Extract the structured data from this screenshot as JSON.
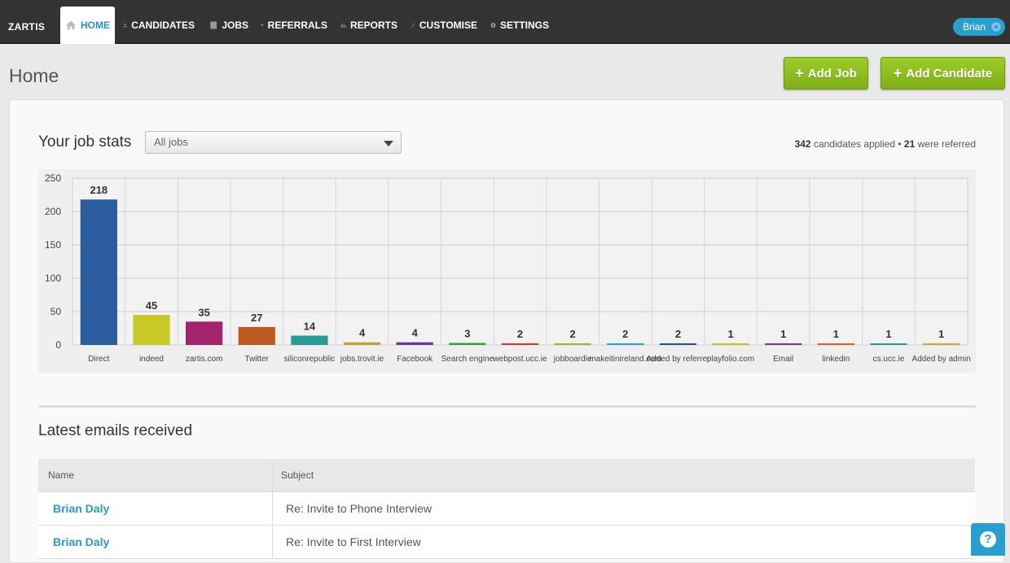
{
  "app": {
    "brand": "ZARTIS"
  },
  "nav": [
    {
      "label": "HOME",
      "icon": "home-icon",
      "active": true
    },
    {
      "label": "CANDIDATES",
      "icon": "person-icon"
    },
    {
      "label": "JOBS",
      "icon": "document-icon"
    },
    {
      "label": "REFERRALS",
      "icon": "handshake-icon"
    },
    {
      "label": "REPORTS",
      "icon": "bar-chart-icon"
    },
    {
      "label": "CUSTOMISE",
      "icon": "brush-icon"
    },
    {
      "label": "SETTINGS",
      "icon": "gear-icon"
    }
  ],
  "user": {
    "name": "Brian",
    "icon": "gear-icon"
  },
  "page": {
    "title": "Home"
  },
  "actions": {
    "add_job": "Add Job",
    "add_candidate": "Add Candidate",
    "plus": "+"
  },
  "stats": {
    "title": "Your job stats",
    "filter_value": "All jobs",
    "candidates_count": "342",
    "candidates_label": "candidates applied",
    "separator": "•",
    "referred_count": "21",
    "referred_label": "were referred"
  },
  "chart_data": {
    "type": "bar",
    "categories": [
      "Direct",
      "indeed",
      "zartis.com",
      "Twitter",
      "siliconrepublic",
      "jobs.trovit.ie",
      "Facebook",
      "Search engine",
      "webpost.ucc.ie",
      "jobboardie",
      "makeitinireland.com",
      "Added by referrer",
      "playfolio.com",
      "Email",
      "linkedin",
      "cs.ucc.ie",
      "Added by admin"
    ],
    "values": [
      218,
      45,
      35,
      27,
      14,
      4,
      4,
      3,
      2,
      2,
      2,
      2,
      1,
      1,
      1,
      1,
      1
    ],
    "colors": [
      "#2b5c9e",
      "#c8c927",
      "#a3246e",
      "#c05a23",
      "#2a9a95",
      "#c0a23a",
      "#6a35a0",
      "#3aa13a",
      "#c73a2e",
      "#9cb32e",
      "#2b9ed0",
      "#2b4f9e",
      "#c8c027",
      "#8e2f77",
      "#d0622e",
      "#2a9a95",
      "#c8a93a"
    ],
    "ylim": [
      0,
      250
    ],
    "yticks": [
      0,
      50,
      100,
      150,
      200,
      250
    ],
    "grid": true,
    "data_labels": true
  },
  "emails": {
    "title": "Latest emails received",
    "columns": [
      "Name",
      "Subject"
    ],
    "rows": [
      {
        "name": "Brian Daly",
        "subject": "Re: Invite to Phone Interview"
      },
      {
        "name": "Brian Daly",
        "subject": "Re: Invite to First Interview"
      }
    ]
  },
  "help": {
    "label": "?",
    "icon": "help-icon"
  }
}
